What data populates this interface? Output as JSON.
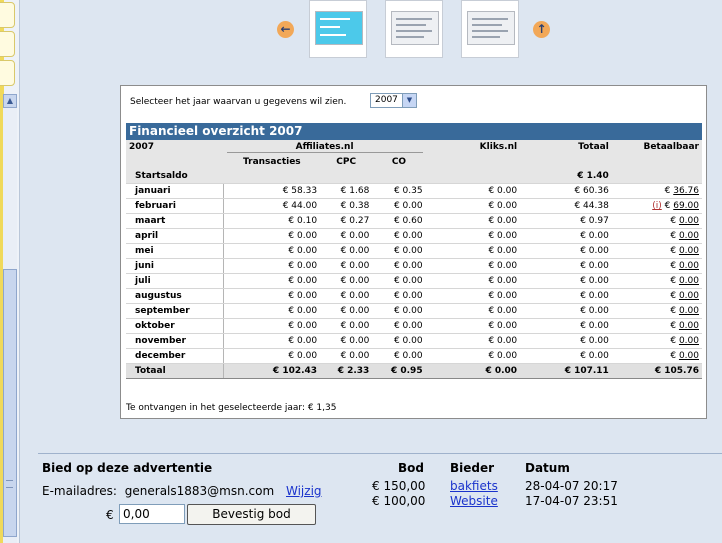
{
  "year_select": {
    "label": "Selecteer het jaar waarvan u gegevens wil zien.",
    "value": "2007"
  },
  "overview": {
    "title": "Financieel overzicht 2007",
    "col_year": "2007",
    "group_affiliates": "Affiliates.nl",
    "col_transacties": "Transacties",
    "col_cpc": "CPC",
    "col_co": "CO",
    "col_kliks": "Kliks.nl",
    "col_totaal": "Totaal",
    "col_betaalbaar": "Betaalbaar",
    "startsaldo_label": "Startsaldo",
    "startsaldo_value": "€ 1.40",
    "rows": [
      {
        "month": "januari",
        "trans": "€ 58.33",
        "cpc": "€ 1.68",
        "co": "€ 0.35",
        "kliks": "€ 0.00",
        "totaal": "€ 60.36",
        "currency": "€",
        "betaalbaar": "36.76",
        "info": ""
      },
      {
        "month": "februari",
        "trans": "€ 44.00",
        "cpc": "€ 0.38",
        "co": "€ 0.00",
        "kliks": "€ 0.00",
        "totaal": "€ 44.38",
        "currency": "€",
        "betaalbaar": "69.00",
        "info": "(i)"
      },
      {
        "month": "maart",
        "trans": "€ 0.10",
        "cpc": "€ 0.27",
        "co": "€ 0.60",
        "kliks": "€ 0.00",
        "totaal": "€ 0.97",
        "currency": "€",
        "betaalbaar": "0.00",
        "info": ""
      },
      {
        "month": "april",
        "trans": "€ 0.00",
        "cpc": "€ 0.00",
        "co": "€ 0.00",
        "kliks": "€ 0.00",
        "totaal": "€ 0.00",
        "currency": "€",
        "betaalbaar": "0.00",
        "info": ""
      },
      {
        "month": "mei",
        "trans": "€ 0.00",
        "cpc": "€ 0.00",
        "co": "€ 0.00",
        "kliks": "€ 0.00",
        "totaal": "€ 0.00",
        "currency": "€",
        "betaalbaar": "0.00",
        "info": ""
      },
      {
        "month": "juni",
        "trans": "€ 0.00",
        "cpc": "€ 0.00",
        "co": "€ 0.00",
        "kliks": "€ 0.00",
        "totaal": "€ 0.00",
        "currency": "€",
        "betaalbaar": "0.00",
        "info": ""
      },
      {
        "month": "juli",
        "trans": "€ 0.00",
        "cpc": "€ 0.00",
        "co": "€ 0.00",
        "kliks": "€ 0.00",
        "totaal": "€ 0.00",
        "currency": "€",
        "betaalbaar": "0.00",
        "info": ""
      },
      {
        "month": "augustus",
        "trans": "€ 0.00",
        "cpc": "€ 0.00",
        "co": "€ 0.00",
        "kliks": "€ 0.00",
        "totaal": "€ 0.00",
        "currency": "€",
        "betaalbaar": "0.00",
        "info": ""
      },
      {
        "month": "september",
        "trans": "€ 0.00",
        "cpc": "€ 0.00",
        "co": "€ 0.00",
        "kliks": "€ 0.00",
        "totaal": "€ 0.00",
        "currency": "€",
        "betaalbaar": "0.00",
        "info": ""
      },
      {
        "month": "oktober",
        "trans": "€ 0.00",
        "cpc": "€ 0.00",
        "co": "€ 0.00",
        "kliks": "€ 0.00",
        "totaal": "€ 0.00",
        "currency": "€",
        "betaalbaar": "0.00",
        "info": ""
      },
      {
        "month": "november",
        "trans": "€ 0.00",
        "cpc": "€ 0.00",
        "co": "€ 0.00",
        "kliks": "€ 0.00",
        "totaal": "€ 0.00",
        "currency": "€",
        "betaalbaar": "0.00",
        "info": ""
      },
      {
        "month": "december",
        "trans": "€ 0.00",
        "cpc": "€ 0.00",
        "co": "€ 0.00",
        "kliks": "€ 0.00",
        "totaal": "€ 0.00",
        "currency": "€",
        "betaalbaar": "0.00",
        "info": ""
      }
    ],
    "total": {
      "label": "Totaal",
      "trans": "€ 102.43",
      "cpc": "€ 2.33",
      "co": "€ 0.95",
      "kliks": "€ 0.00",
      "totaal": "€ 107.11",
      "betaalbaar": "€ 105.76"
    },
    "footer": "Te ontvangen in het geselecteerde jaar: € 1,35"
  },
  "bid": {
    "title": "Bied op deze advertentie",
    "email_label": "E-mailadres:",
    "email": "generals1883@msn.com",
    "change_link": "Wijzig",
    "currency": "€",
    "amount_value": "0,00",
    "submit_label": "Bevestig bod",
    "col_bod": "Bod",
    "col_bieder": "Bieder",
    "col_datum": "Datum",
    "bids": [
      {
        "bod": "€ 150,00",
        "bieder": "bakfiets",
        "datum": "28-04-07 20:17"
      },
      {
        "bod": "€ 100,00",
        "bieder": "Website",
        "datum": "17-04-07 23:51"
      }
    ]
  },
  "icons": {
    "prev": "arrow-left-icon",
    "next": "arrow-up-icon"
  },
  "colors": {
    "header_blue": "#396a9a",
    "accent_orange": "#f2a858",
    "link_blue": "#1a33cc",
    "info_red": "#b03030"
  }
}
